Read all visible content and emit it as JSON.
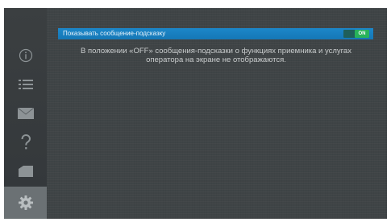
{
  "sidebar": {
    "items": [
      {
        "icon": "info-icon"
      },
      {
        "icon": "list-icon"
      },
      {
        "icon": "mail-icon"
      },
      {
        "icon": "help-icon"
      },
      {
        "icon": "card-icon"
      },
      {
        "icon": "gear-icon"
      }
    ],
    "active_item": "gear-icon"
  },
  "option": {
    "label": "Показывать сообщение-подсказку",
    "toggle_state": "ON"
  },
  "help_text": "В положении «OFF» сообщения-подсказки о функциях приемника и услугах оператора на экране не отображаются.",
  "colors": {
    "highlight": "#1a82c4",
    "toggle_on": "#27b35a",
    "background": "#3f4446",
    "sidebar_active": "#6b7174"
  }
}
